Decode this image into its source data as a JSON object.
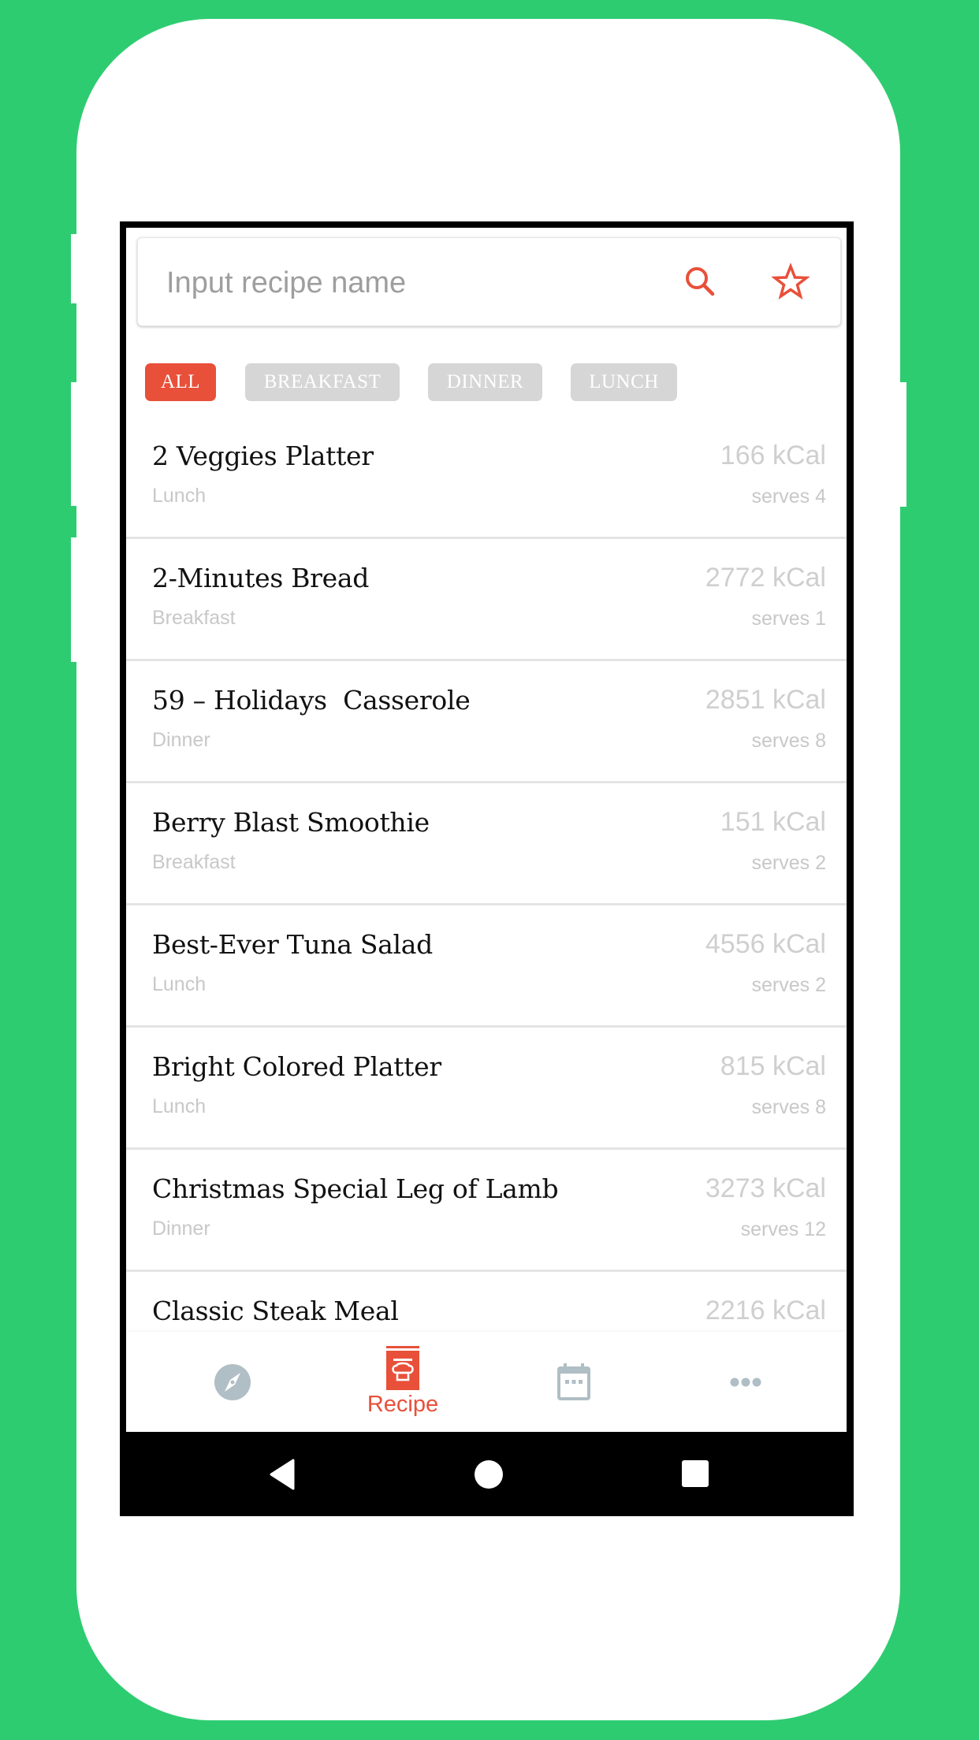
{
  "colors": {
    "background": "#2ECC71",
    "accent": "#E8503A",
    "chip_inactive": "#D6D6D6",
    "icon_inactive": "#B0BEC5",
    "muted_text": "#C8C8C8"
  },
  "search": {
    "placeholder": "Input recipe name",
    "value": "",
    "search_icon": "search-icon",
    "favorite_icon": "star-outline-icon"
  },
  "filters": [
    {
      "label": "ALL",
      "active": true
    },
    {
      "label": "BREAKFAST",
      "active": false
    },
    {
      "label": "DINNER",
      "active": false
    },
    {
      "label": "LUNCH",
      "active": false
    }
  ],
  "recipes": [
    {
      "name": "2 Veggies Platter",
      "category": "Lunch",
      "kcal": "166 kCal",
      "serves": "serves 4"
    },
    {
      "name": "2-Minutes Bread",
      "category": "Breakfast",
      "kcal": "2772 kCal",
      "serves": "serves 1"
    },
    {
      "name": "59 – Holidays  Casserole",
      "category": "Dinner",
      "kcal": "2851 kCal",
      "serves": "serves 8"
    },
    {
      "name": "Berry Blast Smoothie",
      "category": "Breakfast",
      "kcal": "151 kCal",
      "serves": "serves 2"
    },
    {
      "name": "Best-Ever Tuna Salad",
      "category": "Lunch",
      "kcal": "4556 kCal",
      "serves": "serves 2"
    },
    {
      "name": "Bright Colored Platter",
      "category": "Lunch",
      "kcal": "815 kCal",
      "serves": "serves 8"
    },
    {
      "name": "Christmas Special Leg of Lamb",
      "category": "Dinner",
      "kcal": "3273 kCal",
      "serves": "serves 12"
    },
    {
      "name": "Classic Steak Meal",
      "category": "",
      "kcal": "2216 kCal",
      "serves": ""
    }
  ],
  "tabs": [
    {
      "id": "discover",
      "icon": "compass-icon",
      "label": "",
      "active": false
    },
    {
      "id": "recipe",
      "icon": "recipe-book-icon",
      "label": "Recipe",
      "active": true
    },
    {
      "id": "calendar",
      "icon": "calendar-icon",
      "label": "",
      "active": false
    },
    {
      "id": "more",
      "icon": "more-dots-icon",
      "label": "",
      "active": false
    }
  ],
  "system_nav": {
    "back": "back-icon",
    "home": "home-icon",
    "recents": "recents-icon"
  }
}
